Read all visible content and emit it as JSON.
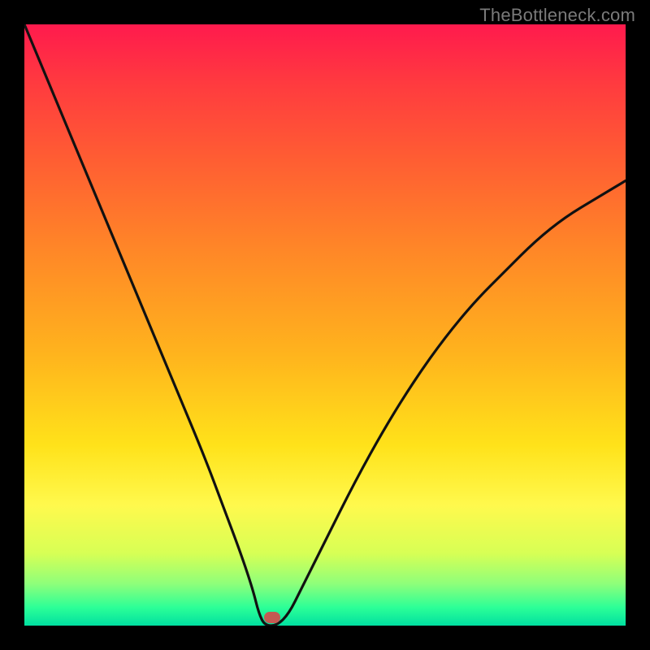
{
  "watermark": "TheBottleneck.com",
  "marker": {
    "x_pct": 41.2,
    "y_pct": 98.6
  },
  "colors": {
    "curve_stroke": "#111111",
    "marker_fill": "#c45a52",
    "frame_bg": "#000000"
  },
  "chart_data": {
    "type": "line",
    "title": "",
    "xlabel": "",
    "ylabel": "",
    "xlim": [
      0,
      100
    ],
    "ylim": [
      0,
      100
    ],
    "series": [
      {
        "name": "bottleneck-curve",
        "x": [
          0,
          5,
          10,
          15,
          20,
          25,
          30,
          33,
          36,
          38,
          39,
          40,
          42,
          44,
          46,
          50,
          55,
          60,
          65,
          70,
          75,
          80,
          85,
          90,
          95,
          100
        ],
        "y": [
          100,
          88,
          76,
          64,
          52,
          40,
          28,
          20,
          12,
          6,
          2,
          0,
          0,
          2,
          6,
          14,
          24,
          33,
          41,
          48,
          54,
          59,
          64,
          68,
          71,
          74
        ]
      }
    ],
    "annotations": [
      {
        "type": "marker",
        "x": 41.2,
        "y": 1.4,
        "label": "optimal-point"
      }
    ]
  }
}
